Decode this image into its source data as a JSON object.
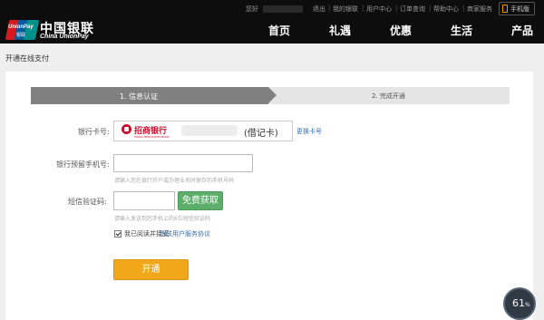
{
  "header": {
    "logo_text": "UnionPay",
    "logo_sub": "银联",
    "brand_cn": "中国银联",
    "brand_en": "China UnionPay",
    "greeting": "您好",
    "util_links": [
      "退出",
      "我的银联",
      "用户中心",
      "订单查询",
      "帮助中心",
      "商家服务"
    ],
    "mobile_label": "手机版",
    "nav": [
      "首页",
      "礼遇",
      "优惠",
      "生活",
      "产品"
    ]
  },
  "breadcrumb": "开通在线支付",
  "steps": {
    "step1": "1. 信息认证",
    "step2": "2. 完成开通"
  },
  "form": {
    "card_label": "银行卡号:",
    "bank_name": "招商银行",
    "bank_name_en": "CHINA MERCHANTS BANK",
    "card_type": "(借记卡)",
    "change_card": "更换卡号",
    "phone_label": "银行预留手机号:",
    "phone_value": "",
    "phone_hint": "请输入您在银行开户或办理业务时留存的手机号码",
    "sms_label": "短信验证码:",
    "sms_value": "",
    "sms_button": "免费获取",
    "sms_hint": "请输入发送到您手机上的6位短信验证码",
    "agree_checked": true,
    "agree_text": "我已阅读并接受",
    "agree_link": "银联用户服务协议",
    "submit_label": "开通"
  },
  "widget": {
    "value": "61",
    "unit": "%"
  },
  "colors": {
    "topbar": "#0d0d0d",
    "step_active": "#808080",
    "step_inactive": "#e5e5e5",
    "sms_button": "#5cae6a",
    "submit_button": "#f0a81a",
    "link": "#3a6fb0"
  }
}
